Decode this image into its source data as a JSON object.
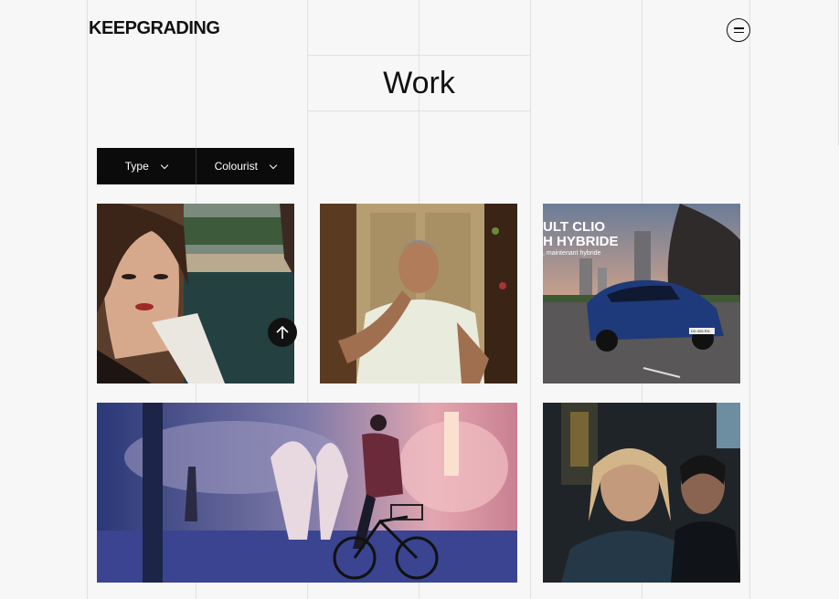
{
  "header": {
    "logo": "KEEPGRADING",
    "menu_icon": "menu-lines-icon"
  },
  "page": {
    "title": "Work"
  },
  "filters": [
    {
      "label": "Type"
    },
    {
      "label": "Colourist"
    }
  ],
  "tiles": {
    "clio": {
      "line1": "ULT CLIO",
      "line2": "H HYBRIDE",
      "line3": ", maintenant hybride",
      "plate": "DD 406 RN"
    }
  },
  "icons": {
    "scroll_top": "arrow-up-icon",
    "chevron": "chevron-down-icon"
  }
}
